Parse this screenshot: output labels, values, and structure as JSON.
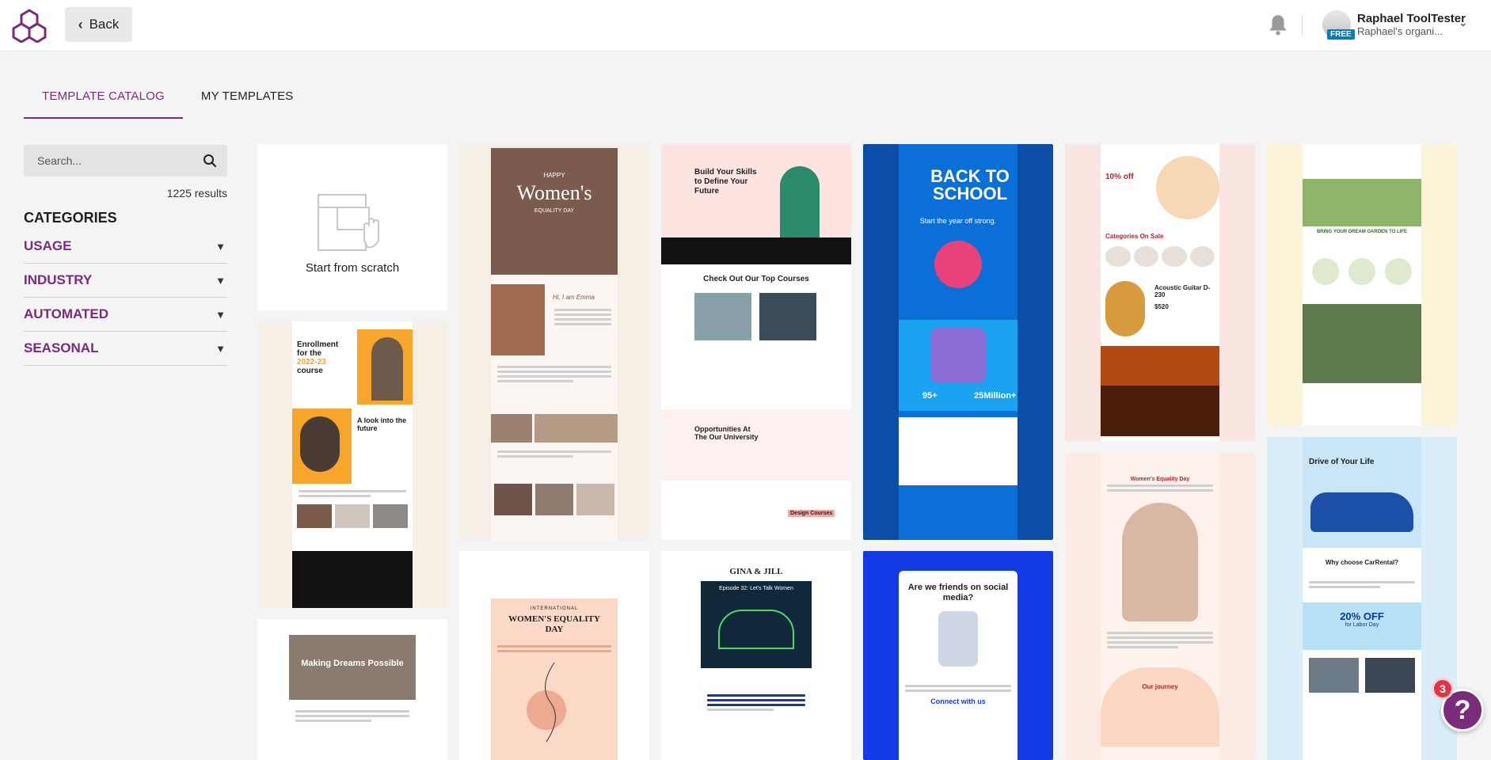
{
  "topbar": {
    "back_label": "Back",
    "user_name": "Raphael ToolTester",
    "user_org": "Raphael's organi...",
    "plan_badge": "FREE"
  },
  "tabs": [
    {
      "label": "TEMPLATE CATALOG",
      "active": true
    },
    {
      "label": "MY TEMPLATES",
      "active": false
    }
  ],
  "sidebar": {
    "search_placeholder": "Search...",
    "results": "1225 results",
    "categories_title": "CATEGORIES",
    "categories": [
      "USAGE",
      "INDUSTRY",
      "AUTOMATED",
      "SEASONAL"
    ]
  },
  "templates": {
    "scratch_label": "Start from scratch",
    "t1": {
      "lines": [
        "Enrollment",
        "for the",
        "2022-23",
        "course"
      ],
      "sub": "A look into the future"
    },
    "t2": {
      "top": "HAPPY",
      "big": "Women's",
      "small": "EQUALITY DAY",
      "greet": "Hi, I am Emma"
    },
    "t3": {
      "head": "Build Your Skills to Define Your Future",
      "courses": "Check Out Our Top Courses",
      "opps": "Opportunities At The Our University",
      "design": "Design Courses"
    },
    "t4": {
      "title": "BACK TO SCHOOL",
      "sub": "Start the year off strong.",
      "stat1": "95+",
      "stat2": "25Million+"
    },
    "t5": {
      "offer": "10% off",
      "cats": "Categories On Sale",
      "product": "Acoustic Guitar D-230",
      "price": "$520"
    },
    "t6": {
      "title": "BRING YOUR DREAM GARDEN TO LIFE"
    },
    "t7": {
      "title": "Making Dreams Possible"
    },
    "t8": {
      "top": "INTERNATIONAL",
      "big": "WOMEN'S EQUALITY DAY"
    },
    "t9": {
      "title": "GINA & JILL",
      "ep": "Episode 32: Let's Talk Women"
    },
    "t10": {
      "title": "Are we friends on social media?",
      "connect": "Connect with us"
    },
    "t11": {
      "title": "Women's Equality Day",
      "journey": "Our journey"
    },
    "t12": {
      "title": "Drive of Your Life",
      "why": "Why choose CarRental?",
      "offer": "20% OFF",
      "sub": "for Labor Day"
    }
  },
  "help": {
    "glyph": "?",
    "badge": "3"
  },
  "colors": {
    "brand": "#7a2b7a",
    "badge": "#e0344a"
  }
}
